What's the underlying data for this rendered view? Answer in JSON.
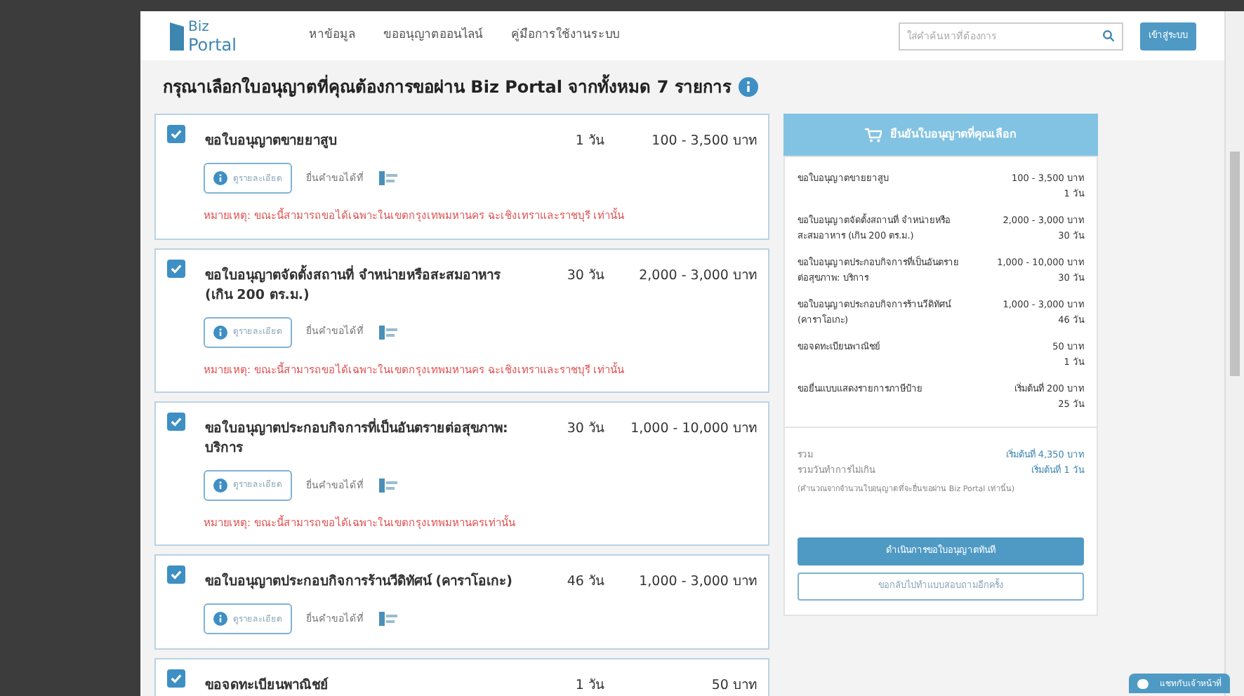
{
  "header": {
    "logo": {
      "line1": "Biz",
      "line2": "Portal"
    },
    "nav": [
      "หาข้อมูล",
      "ขออนุญาตออนไลน์",
      "คู่มือการใช้งานระบบ"
    ],
    "search": {
      "placeholder": "ใส่คำค้นหาที่ต้องการ"
    },
    "login_button": "เข้าสู่ระบบ"
  },
  "heading": "กรุณาเลือกใบอนุญาตที่คุณต้องการขอผ่าน Biz Portal จากทั้งหมด 7 รายการ",
  "permits": [
    {
      "name": "ขอใบอนุญาตขายยาสูบ",
      "days": "1 วัน",
      "fee": "100 - 3,500 บาท",
      "checked": true,
      "details_button": "ดูรายละเอียด",
      "submit_at": "ยื่นคำขอได้ที่",
      "note": "หมายเหตุ: ขณะนี้สามารถขอได้เฉพาะในเขตกรุงเทพมหานคร ฉะเชิงเทราและราชบุรี เท่านั้น"
    },
    {
      "name": "ขอใบอนุญาตจัดตั้งสถานที่ จำหน่ายหรือสะสมอาหาร (เกิน 200 ตร.ม.)",
      "days": "30 วัน",
      "fee": "2,000 - 3,000 บาท",
      "checked": true,
      "details_button": "ดูรายละเอียด",
      "submit_at": "ยื่นคำขอได้ที่",
      "note": "หมายเหตุ: ขณะนี้สามารถขอได้เฉพาะในเขตกรุงเทพมหานคร ฉะเชิงเทราและราชบุรี เท่านั้น"
    },
    {
      "name": "ขอใบอนุญาตประกอบกิจการที่เป็นอันตรายต่อสุขภาพ: บริการ",
      "days": "30 วัน",
      "fee": "1,000 - 10,000 บาท",
      "checked": true,
      "details_button": "ดูรายละเอียด",
      "submit_at": "ยื่นคำขอได้ที่",
      "note": "หมายเหตุ: ขณะนี้สามารถขอได้เฉพาะในเขตกรุงเทพมหานครเท่านั้น"
    },
    {
      "name": "ขอใบอนุญาตประกอบกิจการร้านวีดิทัศน์ (คาราโอเกะ)",
      "days": "46 วัน",
      "fee": "1,000 - 3,000 บาท",
      "checked": true,
      "details_button": "ดูรายละเอียด",
      "submit_at": "ยื่นคำขอได้ที่"
    },
    {
      "name": "ขอจดทะเบียนพาณิชย์",
      "days": "1 วัน",
      "fee": "50 บาท",
      "checked": true
    }
  ],
  "cart": {
    "title": "ยืนยันใบอนุญาตที่คุณเลือก",
    "items": [
      {
        "name": "ขอใบอนุญาตขายยาสูบ",
        "fee": "100 - 3,500 บาท",
        "days": "1 วัน"
      },
      {
        "name": "ขอใบอนุญาตจัดตั้งสถานที่ จำหน่ายหรือสะสมอาหาร (เกิน 200 ตร.ม.)",
        "fee": "2,000 - 3,000 บาท",
        "days": "30 วัน"
      },
      {
        "name": "ขอใบอนุญาตประกอบกิจการที่เป็นอันตรายต่อสุขภาพ: บริการ",
        "fee": "1,000 - 10,000 บาท",
        "days": "30 วัน"
      },
      {
        "name": "ขอใบอนุญาตประกอบกิจการร้านวีดิทัศน์ (คาราโอเกะ)",
        "fee": "1,000 - 3,000 บาท",
        "days": "46 วัน"
      },
      {
        "name": "ขอจดทะเบียนพาณิชย์",
        "fee": "50 บาท",
        "days": "1 วัน"
      },
      {
        "name": "ขอยื่นแบบแสดงรายการภาษีป้าย",
        "fee": "เริ่มต้นที่ 200 บาท",
        "days": "25 วัน"
      }
    ],
    "totals": [
      {
        "label": "รวม",
        "value": "เริ่มต้นที่ 4,350 บาท"
      },
      {
        "label": "รวมวันทำการไม่เกิน",
        "value": "เริ่มต้นที่ 1 วัน"
      }
    ],
    "footnote": "(คำนวณจากจำนวนใบอนุญาตที่จะยื่นขอผ่าน Biz Portal เท่านั้น)",
    "primary_button": "ดำเนินการขอใบอนุญาตทันที",
    "secondary_button": "ขอกลับไปทำแบบสอบถามอีกครั้ง"
  },
  "chat_button": "แชทกับเจ้าหน้าที่"
}
